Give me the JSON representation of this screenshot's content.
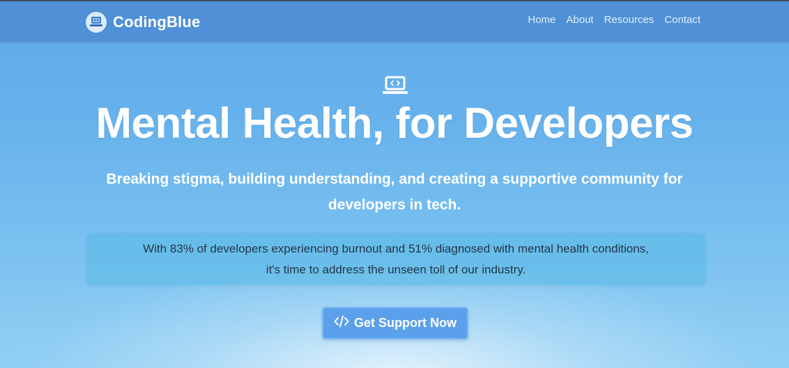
{
  "navbar": {
    "brand_name": "CodingBlue",
    "logo_icon": "laptop-robot-icon",
    "links": [
      {
        "label": "Home"
      },
      {
        "label": "About"
      },
      {
        "label": "Resources"
      },
      {
        "label": "Contact"
      }
    ]
  },
  "hero": {
    "icon": "laptop-code-icon",
    "title": "Mental Health, for Developers",
    "subtitle": "Breaking stigma, building understanding, and creating a supportive community for developers in tech.",
    "stat_text": "With 83% of developers experiencing burnout and 51% diagnosed with mental health conditions, it's time to address the unseen toll of our industry.",
    "cta": {
      "icon": "code-icon",
      "label": "Get Support Now"
    }
  },
  "colors": {
    "navbar": "#4f90d6",
    "hero_background": "#68b3ec",
    "stat_box": "#58b9e4",
    "cta_button": "#5ba0ea",
    "text_light": "#ffffff",
    "text_dark": "#24364a"
  }
}
